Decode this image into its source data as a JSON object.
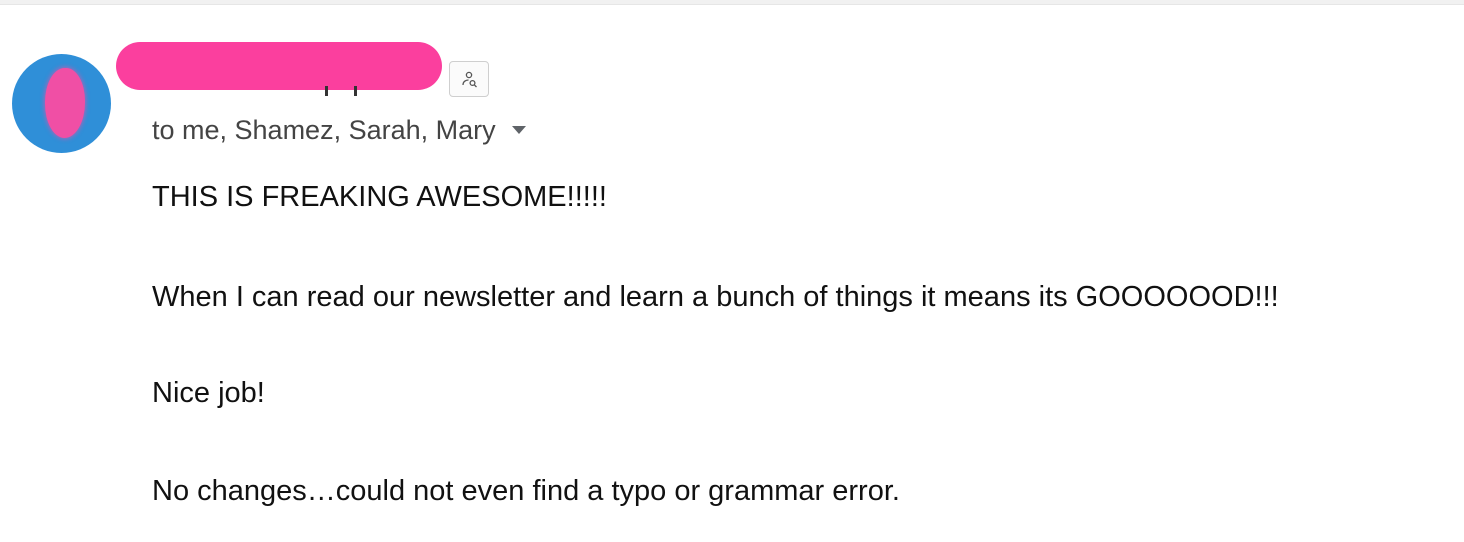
{
  "email": {
    "recipients_text": "to me, Shamez, Sarah, Mary",
    "body": [
      "THIS IS FREAKING AWESOME!!!!!",
      "When I can read our newsletter and learn a bunch of things it means its GOOOOOOD!!!",
      "Nice job!",
      "No changes…could not even find a typo or grammar error."
    ]
  },
  "colors": {
    "redaction": "#fb3f9e",
    "avatar": "#2f8fd8"
  },
  "icons": {
    "contact_button": "person-search-icon",
    "details": "chevron-down-icon"
  }
}
